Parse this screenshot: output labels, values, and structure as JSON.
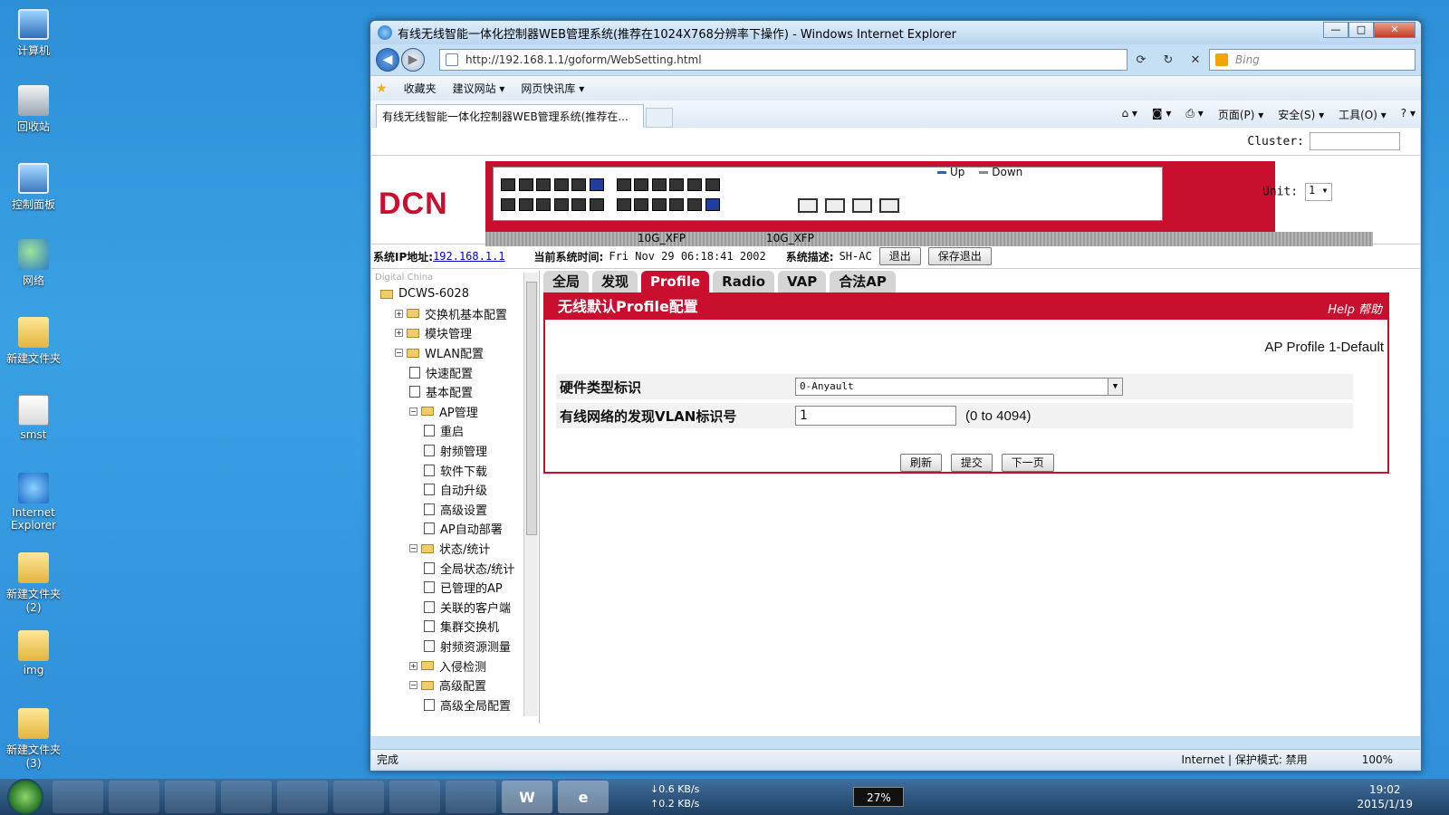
{
  "desktop": {
    "icons": [
      {
        "label": "计算机",
        "icon": "computer-icon"
      },
      {
        "label": "回收站",
        "icon": "recycle-bin-icon"
      },
      {
        "label": "控制面板",
        "icon": "control-panel-icon"
      },
      {
        "label": "网络",
        "icon": "network-icon"
      },
      {
        "label": "新建文件夹",
        "icon": "folder-icon"
      },
      {
        "label": "smst",
        "icon": "document-icon"
      },
      {
        "label": "Internet Explorer",
        "icon": "ie-icon"
      },
      {
        "label": "新建文件夹 (2)",
        "icon": "folder-icon"
      },
      {
        "label": "img",
        "icon": "folder-icon"
      },
      {
        "label": "新建文件夹 (3)",
        "icon": "folder-icon"
      }
    ]
  },
  "browser": {
    "title": "有线无线智能一体化控制器WEB管理系统(推荐在1024X768分辨率下操作) - Windows Internet Explorer",
    "url": "http://192.168.1.1/goform/WebSetting.html",
    "search_placeholder": "Bing",
    "favorites": [
      "收藏夹",
      "建议网站 ▾",
      "网页快讯库 ▾"
    ],
    "tab_title": "有线无线智能一体化控制器WEB管理系统(推荐在...",
    "commands": [
      "页面(P) ▾",
      "安全(S) ▾",
      "工具(O) ▾",
      "? ▾"
    ],
    "status_left": "完成",
    "status_zone": "Internet | 保护模式: 禁用",
    "zoom": "100%"
  },
  "page": {
    "cluster_label": "Cluster:",
    "logo": "DCN",
    "legend_up": "Up",
    "legend_down": "Down",
    "xfp_label": "10G_XFP",
    "unit_label": "Unit:",
    "unit_value": "1 ▾",
    "sys_ip_label": "系统IP地址:",
    "sys_ip": "192.168.1.1",
    "sys_time_label": "当前系统时间:",
    "sys_time": "Fri Nov 29 06:18:41 2002",
    "sys_desc_label": "系统描述:",
    "sys_desc": "SH-AC",
    "logout": "退出",
    "save_logout": "保存退出",
    "tree_brand": "Digital China",
    "tree": [
      {
        "label": "DCWS-6028",
        "kind": "folder",
        "level": 0
      },
      {
        "label": "交换机基本配置",
        "kind": "folder",
        "level": 1,
        "exp": "+"
      },
      {
        "label": "模块管理",
        "kind": "folder",
        "level": 1,
        "exp": "+"
      },
      {
        "label": "WLAN配置",
        "kind": "folder",
        "level": 1,
        "exp": "−"
      },
      {
        "label": "快速配置",
        "kind": "page",
        "level": 2
      },
      {
        "label": "基本配置",
        "kind": "page",
        "level": 2
      },
      {
        "label": "AP管理",
        "kind": "folder",
        "level": 2,
        "exp": "−"
      },
      {
        "label": "重启",
        "kind": "page",
        "level": 3
      },
      {
        "label": "射频管理",
        "kind": "page",
        "level": 3
      },
      {
        "label": "软件下载",
        "kind": "page",
        "level": 3
      },
      {
        "label": "自动升级",
        "kind": "page",
        "level": 3
      },
      {
        "label": "高级设置",
        "kind": "page",
        "level": 3
      },
      {
        "label": "AP自动部署",
        "kind": "page",
        "level": 3
      },
      {
        "label": "状态/统计",
        "kind": "folder",
        "level": 2,
        "exp": "−"
      },
      {
        "label": "全局状态/统计",
        "kind": "page",
        "level": 3
      },
      {
        "label": "已管理的AP",
        "kind": "page",
        "level": 3
      },
      {
        "label": "关联的客户端",
        "kind": "page",
        "level": 3
      },
      {
        "label": "集群交换机",
        "kind": "page",
        "level": 3
      },
      {
        "label": "射频资源测量",
        "kind": "page",
        "level": 3
      },
      {
        "label": "入侵检测",
        "kind": "folder",
        "level": 2,
        "exp": "+"
      },
      {
        "label": "高级配置",
        "kind": "folder",
        "level": 2,
        "exp": "−"
      },
      {
        "label": "高级全局配置",
        "kind": "page",
        "level": 3
      }
    ],
    "tabs": [
      "全局",
      "发现",
      "Profile",
      "Radio",
      "VAP",
      "合法AP"
    ],
    "active_tab": "Profile",
    "panel_title": "无线默认Profile配置",
    "help_label": "Help 帮助",
    "profile_name": "AP Profile 1-Default",
    "field1_label": "硬件类型标识",
    "field1_value": "0-Anyault",
    "field2_label": "有线网络的发现VLAN标识号",
    "field2_value": "1",
    "field2_range": "(0 to 4094)",
    "btn_refresh": "刷新",
    "btn_submit": "提交",
    "btn_next": "下一页"
  },
  "taskbar": {
    "items": [
      "",
      "",
      "",
      "",
      "",
      "",
      "",
      "",
      "W",
      "e"
    ],
    "net_down": "↓0.6 KB/s",
    "net_up": "↑0.2 KB/s",
    "battery": "27%",
    "time": "19:02",
    "date": "2015/1/19"
  }
}
